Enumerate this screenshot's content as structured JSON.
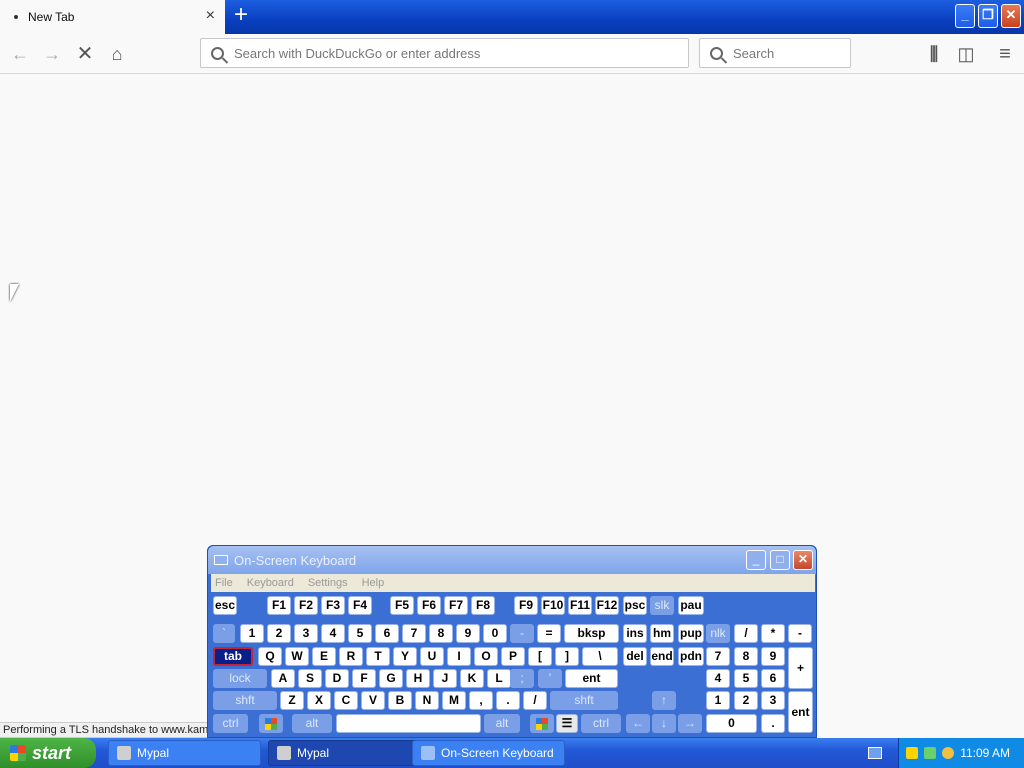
{
  "browser": {
    "tab_title": "New Tab",
    "tab_close": "×",
    "new_tab": "+",
    "url_placeholder": "Search with DuckDuckGo or enter address",
    "search_placeholder": "Search",
    "status": "Performing a TLS handshake to www.kamt"
  },
  "osk": {
    "title": "On-Screen Keyboard",
    "menu": [
      "File",
      "Keyboard",
      "Settings",
      "Help"
    ],
    "row0": [
      "esc",
      "F1",
      "F2",
      "F3",
      "F4",
      "F5",
      "F6",
      "F7",
      "F8",
      "F9",
      "F10",
      "F11",
      "F12",
      "psc",
      "slk",
      "pau"
    ],
    "row1": [
      "`",
      "1",
      "2",
      "3",
      "4",
      "5",
      "6",
      "7",
      "8",
      "9",
      "0",
      "-",
      "=",
      "bksp",
      "ins",
      "hm",
      "pup",
      "nlk",
      "/",
      "*",
      "-"
    ],
    "row2": [
      "tab",
      "Q",
      "W",
      "E",
      "R",
      "T",
      "Y",
      "U",
      "I",
      "O",
      "P",
      "[",
      "]",
      "\\",
      "del",
      "end",
      "pdn",
      "7",
      "8",
      "9",
      "+"
    ],
    "row3": [
      "lock",
      "A",
      "S",
      "D",
      "F",
      "G",
      "H",
      "J",
      "K",
      "L",
      ";",
      "'",
      "ent",
      "4",
      "5",
      "6"
    ],
    "row4": [
      "shft",
      "Z",
      "X",
      "C",
      "V",
      "B",
      "N",
      "M",
      ",",
      ".",
      "/",
      "shft",
      "↑",
      "1",
      "2",
      "3",
      "ent"
    ],
    "row5": [
      "ctrl",
      "alt",
      "alt",
      "ctrl",
      "←",
      "↓",
      "→",
      "0",
      "."
    ]
  },
  "taskbar": {
    "start": "start",
    "tasks": [
      "Mypal",
      "Mypal",
      "On-Screen Keyboard"
    ],
    "clock": "11:09 AM"
  },
  "colors": {
    "titlebar": "#0a3fc0",
    "osk_bg": "#3b6fd4",
    "taskbar": "#2358d8",
    "start": "#2f8f2a"
  }
}
